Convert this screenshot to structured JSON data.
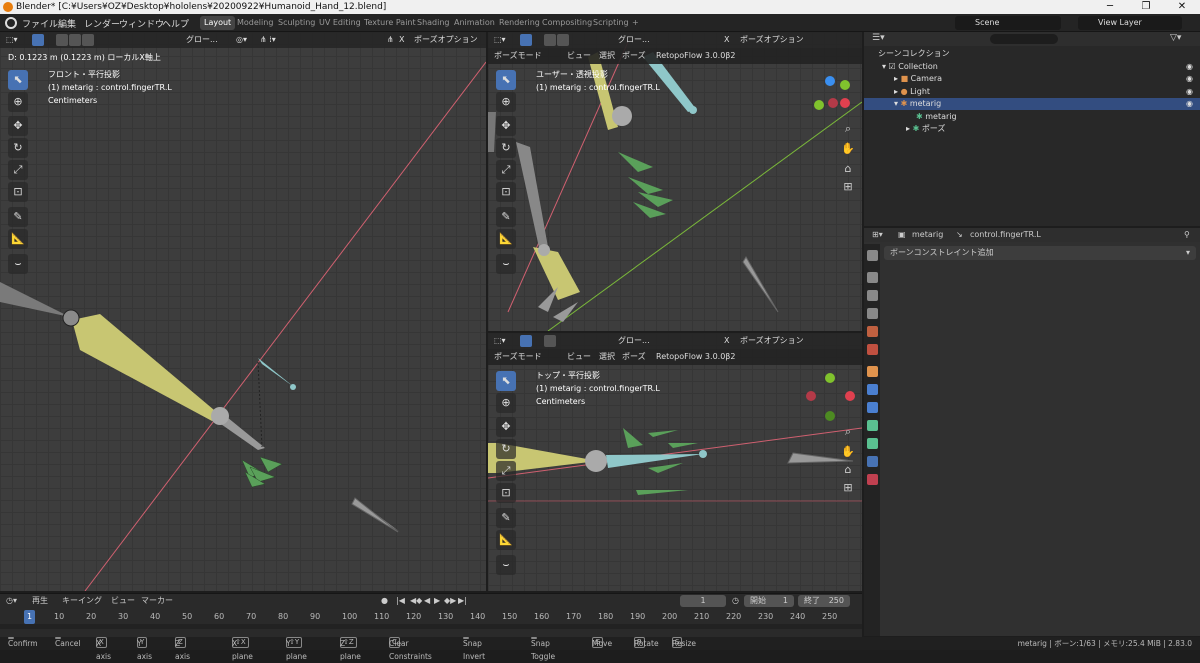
{
  "titlebar": {
    "title": "Blender* [C:¥Users¥OZ¥Desktop¥hololens¥20200922¥Humanoid_Hand_12.blend]",
    "minimize": "─",
    "maximize": "❐",
    "close": "✕"
  },
  "menu": [
    "ファイル",
    "編集",
    "レンダー",
    "ウィンドウ",
    "ヘルプ"
  ],
  "workspaces": [
    "Layout",
    "Modeling",
    "Sculpting",
    "UV Editing",
    "Texture Paint",
    "Shading",
    "Animation",
    "Rendering",
    "Compositing",
    "Scripting",
    "+"
  ],
  "scene": "Scene",
  "view_layer": "View Layer",
  "vp1": {
    "transform": "グロー...",
    "options": "ポーズオプション",
    "close": "X",
    "status": "D: 0.1223 m (0.1223 m) ローカルX軸上",
    "view": "フロント・平行投影",
    "object": "(1) metarig : control.fingerTR.L",
    "units": "Centimeters"
  },
  "vp2": {
    "mode": "ポーズモード",
    "menus": [
      "ビュー",
      "選択",
      "ポーズ"
    ],
    "addon": "RetopoFlow 3.0.0β2",
    "transform": "グロー...",
    "options": "ポーズオプション",
    "view": "ユーザー・透視投影",
    "object": "(1) metarig : control.fingerTR.L"
  },
  "vp3": {
    "mode": "ポーズモード",
    "menus": [
      "ビュー",
      "選択",
      "ポーズ"
    ],
    "addon": "RetopoFlow 3.0.0β2",
    "transform": "グロー...",
    "options": "ポーズオプション",
    "view": "トップ・平行投影",
    "object": "(1) metarig : control.fingerTR.L",
    "units": "Centimeters"
  },
  "outliner": {
    "search": "",
    "header": "シーンコレクション",
    "rows": [
      "Collection",
      "Camera",
      "Light",
      "metarig",
      "metarig",
      "ポーズ"
    ]
  },
  "properties": {
    "object": "metarig",
    "bone": "control.fingerTR.L",
    "add_constraint": "ボーンコンストレイント追加"
  },
  "timeline": {
    "menus": [
      "再生",
      "キーイング",
      "ビュー",
      "マーカー"
    ],
    "current": "1",
    "start_label": "開始",
    "start": "1",
    "end_label": "終了",
    "end": "250",
    "frame_marker": "1",
    "ticks": [
      "10",
      "20",
      "30",
      "40",
      "50",
      "60",
      "70",
      "80",
      "90",
      "100",
      "110",
      "120",
      "130",
      "140",
      "150",
      "160",
      "170",
      "180",
      "190",
      "200",
      "210",
      "220",
      "230",
      "240",
      "250"
    ]
  },
  "status": {
    "items": [
      [
        "",
        "Confirm"
      ],
      [
        "",
        "Cancel"
      ],
      [
        "X",
        "X axis"
      ],
      [
        "Y",
        "Y axis"
      ],
      [
        "Z",
        "Z axis"
      ],
      [
        "⇧X",
        "X plane"
      ],
      [
        "⇧Y",
        "Y plane"
      ],
      [
        "⇧Z",
        "Z plane"
      ],
      [
        "C",
        "Clear Constraints"
      ],
      [
        "",
        "Snap Invert"
      ],
      [
        "",
        "Snap Toggle"
      ],
      [
        "G",
        "Move"
      ],
      [
        "R",
        "Rotate"
      ],
      [
        "S",
        "Resize"
      ]
    ],
    "right": "metarig | ボーン:1/63 | メモリ:25.4 MiB | 2.83.0"
  },
  "colors": {
    "accent": "#4772b3",
    "bone_yellow": "#c8c672",
    "bone_green": "#5aa05a",
    "bone_cyan": "#8fc7c9",
    "axis_x": "#e0404f",
    "axis_y": "#80c22d",
    "axis_z": "#3a8ff0"
  }
}
